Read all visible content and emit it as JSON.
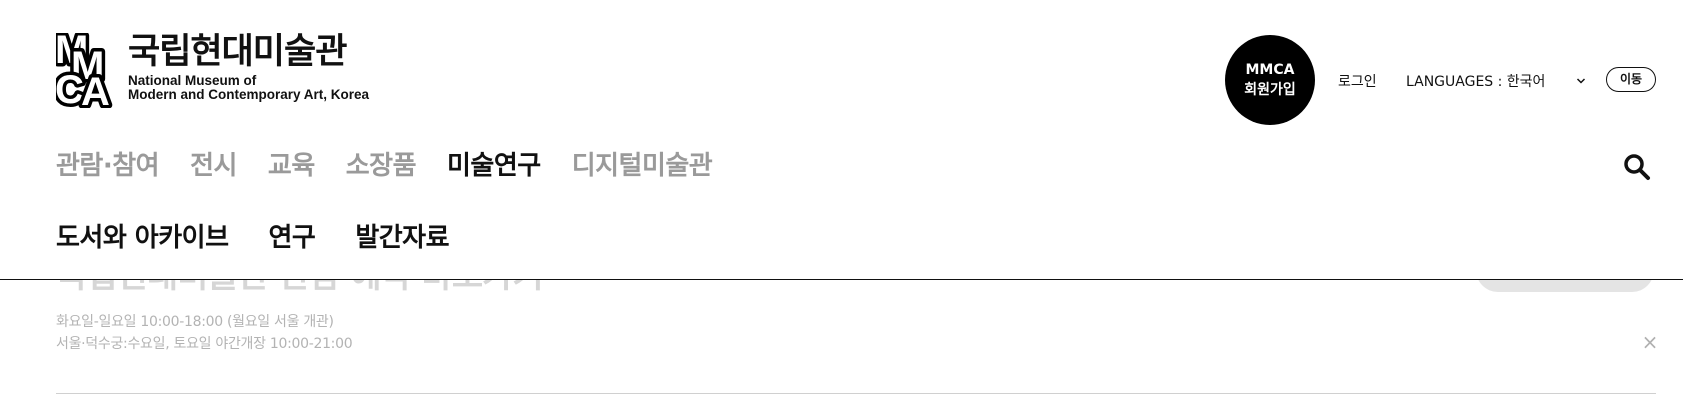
{
  "logo": {
    "mark_letters": [
      "M",
      "M",
      "C",
      "A"
    ],
    "name_kr": "국립현대미술관",
    "name_en_line1": "National Museum of",
    "name_en_line2": "Modern and Contemporary Art, Korea"
  },
  "utility": {
    "join_line1": "MMCA",
    "join_line2": "회원가입",
    "login": "로그인",
    "languages_label": "LANGUAGES : 한국어",
    "go_button": "이동"
  },
  "main_nav": {
    "items": [
      {
        "label": "관람·참여",
        "active": false
      },
      {
        "label": "전시",
        "active": false
      },
      {
        "label": "교육",
        "active": false
      },
      {
        "label": "소장품",
        "active": false
      },
      {
        "label": "미술연구",
        "active": true
      },
      {
        "label": "디지털미술관",
        "active": false
      }
    ]
  },
  "sub_nav": {
    "items": [
      {
        "label": "도서와 아카이브"
      },
      {
        "label": "연구"
      },
      {
        "label": "발간자료"
      }
    ]
  },
  "background": {
    "hours_line1": "화요일-일요일 10:00-18:00 (월요일 서울 개관)",
    "hours_line2": "서울·덕수궁:수요일, 토요일 야간개장 10:00-21:00",
    "close_symbol": "×"
  },
  "colors": {
    "active_nav": "#111111",
    "inactive_nav": "#9a9a9a",
    "join_circle": "#000000"
  }
}
